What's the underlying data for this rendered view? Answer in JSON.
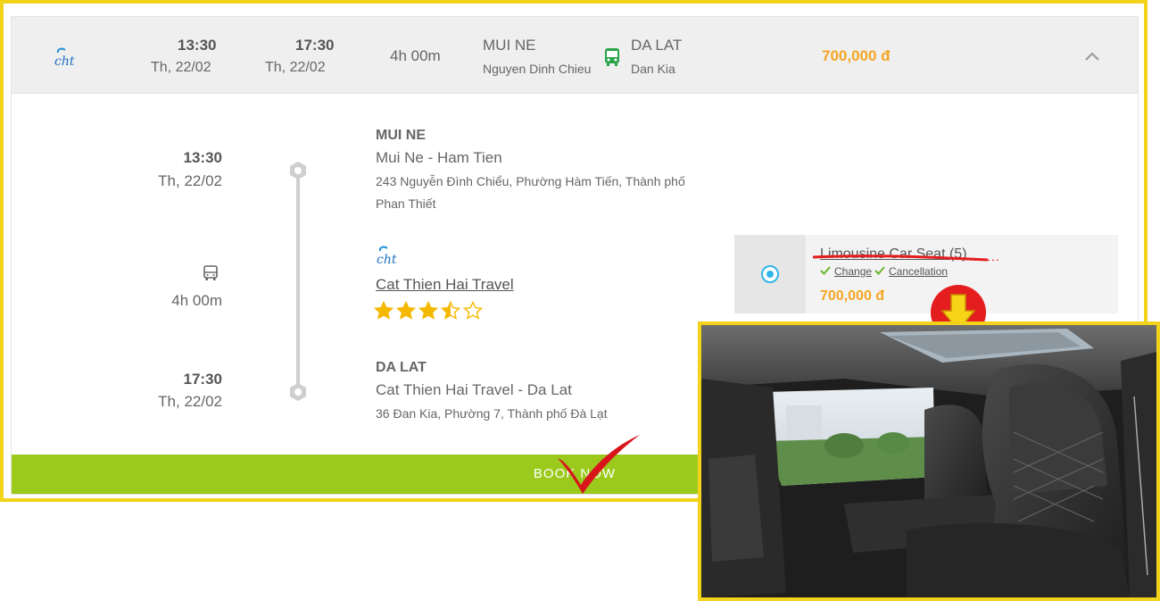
{
  "header": {
    "depart_time": "13:30",
    "depart_date": "Th, 22/02",
    "arrive_time": "17:30",
    "arrive_date": "Th, 22/02",
    "duration": "4h 00m",
    "origin": "MUI NE",
    "origin_sub": "Nguyen Dinh Chieu",
    "destination": "DA LAT",
    "destination_sub": "Dan Kia",
    "price": "700,000 đ",
    "logo_icon": "cat-thien-hai-logo",
    "vehicle_icon": "bus-icon"
  },
  "detail": {
    "depart_time": "13:30",
    "depart_date": "Th, 22/02",
    "duration": "4h 00m",
    "arrive_time": "17:30",
    "arrive_date": "Th, 22/02",
    "origin": {
      "title": "MUI NE",
      "name": "Mui Ne - Ham Tien",
      "address": "243 Nguyễn Đình Chiểu, Phường Hàm Tiến, Thành phố Phan Thiết"
    },
    "company": {
      "name": "Cat Thien Hai Travel",
      "rating": 3.5,
      "rating_max": 5
    },
    "destination": {
      "title": "DA LAT",
      "name": "Cat Thien Hai Travel - Da Lat",
      "address": "36 Đan Kia, Phường 7, Thành phố Đà Lạt"
    }
  },
  "seat_option": {
    "name": "Limousine Car Seat (5)",
    "change_label": "Change",
    "cancellation_label": "Cancellation",
    "price": "700,000 đ",
    "selected": true
  },
  "book_button": "BOOK NOW",
  "colors": {
    "frame": "#f2d21b",
    "price": "#f5a623",
    "button": "#9bca1d",
    "radio": "#2fb5ea",
    "star": "#f5b800",
    "annotation": "#e41e1e"
  }
}
